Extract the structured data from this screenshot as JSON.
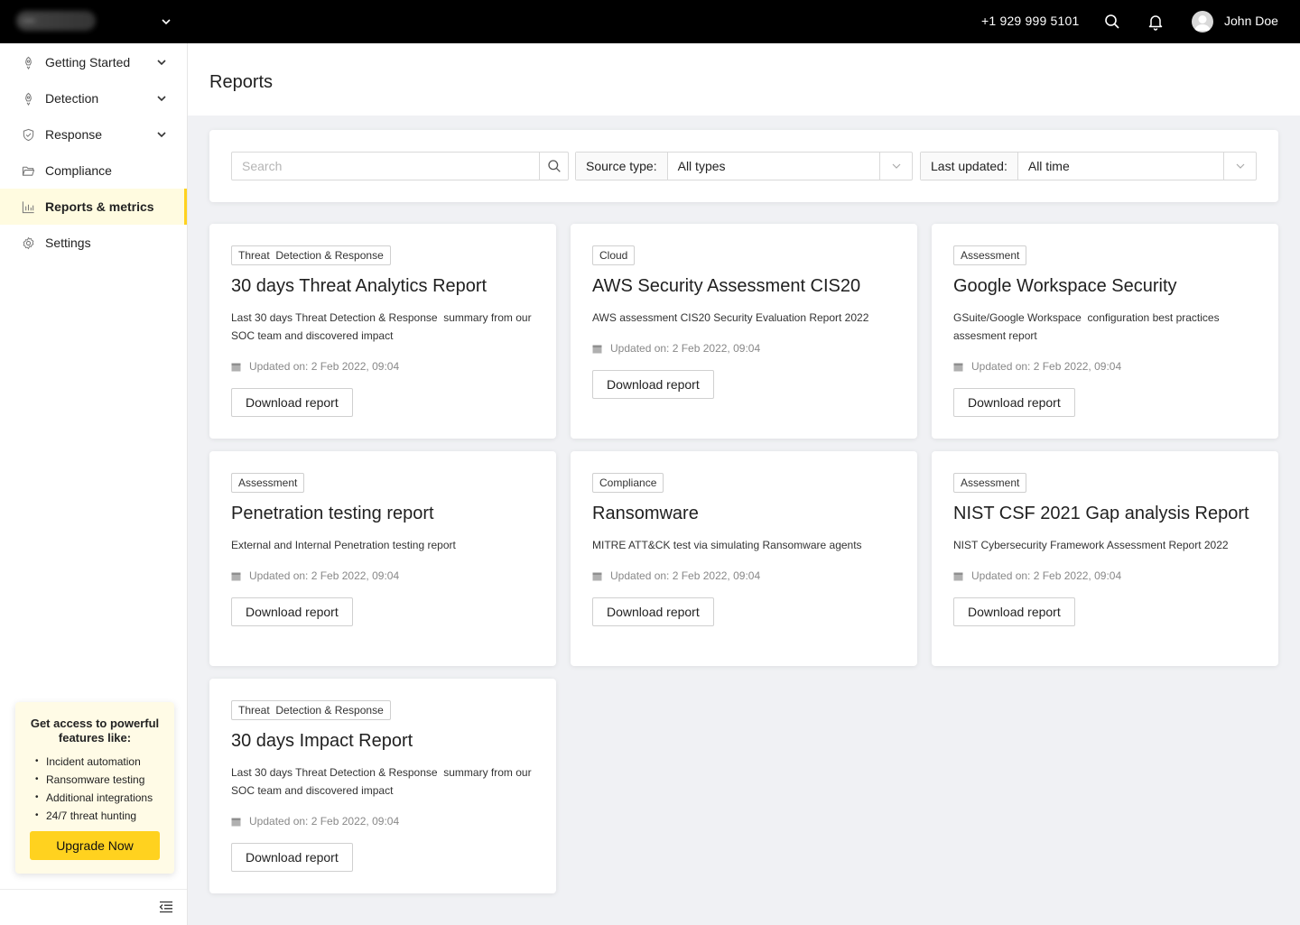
{
  "topbar": {
    "phone": "+1 929 999 5101",
    "username": "John Doe",
    "icons": [
      "logo",
      "chevron-down-icon",
      "search-icon",
      "bell-icon",
      "user-avatar"
    ]
  },
  "sidebar": {
    "items": [
      {
        "label": "Getting Started",
        "icon": "rocket-icon",
        "has_chevron": true
      },
      {
        "label": "Detection",
        "icon": "rocket-icon",
        "has_chevron": true
      },
      {
        "label": "Response",
        "icon": "shield-check-icon",
        "has_chevron": true
      },
      {
        "label": "Compliance",
        "icon": "folder-open-icon",
        "has_chevron": false
      },
      {
        "label": "Reports & metrics",
        "icon": "bar-chart-icon",
        "has_chevron": false,
        "active": true
      },
      {
        "label": "Settings",
        "icon": "gear-icon",
        "has_chevron": false
      }
    ],
    "promo": {
      "title": "Get access to powerful features like:",
      "features": [
        "Incident automation",
        "Ransomware testing",
        "Additional integrations",
        "24/7 threat hunting"
      ],
      "button": "Upgrade Now"
    }
  },
  "main": {
    "title": "Reports",
    "filters": {
      "search_placeholder": "Search",
      "source_type_label": "Source type:",
      "source_type_value": "All types",
      "last_updated_label": "Last updated:",
      "last_updated_value": "All time"
    },
    "cards": [
      {
        "tag": "Threat  Detection & Response",
        "title": "30 days Threat Analytics Report",
        "description": "Last 30 days Threat Detection & Response  summary from our SOC team and discovered impact",
        "updated": "Updated on: 2 Feb 2022, 09:04",
        "button": "Download report"
      },
      {
        "tag": "Cloud",
        "title": "AWS Security Assessment CIS20",
        "description": "AWS assessment CIS20 Security Evaluation Report 2022",
        "updated": "Updated on: 2 Feb 2022, 09:04",
        "button": "Download report"
      },
      {
        "tag": "Assessment",
        "title": "Google Workspace Security",
        "description": "GSuite/Google Workspace  configuration best practices assesment report",
        "updated": "Updated on: 2 Feb 2022, 09:04",
        "button": "Download report"
      },
      {
        "tag": "Assessment",
        "title": "Penetration testing report",
        "description": "External and Internal Penetration testing report",
        "updated": "Updated on: 2 Feb 2022, 09:04",
        "button": "Download report"
      },
      {
        "tag": "Compliance",
        "title": "Ransomware",
        "description": "MITRE ATT&CK test via simulating Ransomware agents",
        "updated": "Updated on: 2 Feb 2022, 09:04",
        "button": "Download report"
      },
      {
        "tag": "Assessment",
        "title": "NIST CSF 2021 Gap analysis Report",
        "description": "NIST Cybersecurity Framework Assessment Report 2022",
        "updated": "Updated on: 2 Feb 2022, 09:04",
        "button": "Download report"
      },
      {
        "tag": "Threat  Detection & Response",
        "title": "30 days Impact Report",
        "description": "Last 30 days Threat Detection & Response  summary from our SOC team and discovered impact",
        "updated": "Updated on: 2 Feb 2022, 09:04",
        "button": "Download report"
      }
    ]
  },
  "colors": {
    "accent": "#ffd21f",
    "active_bg": "#fffbe0",
    "topbar": "#000000",
    "page_bg": "#f0f1f4"
  }
}
